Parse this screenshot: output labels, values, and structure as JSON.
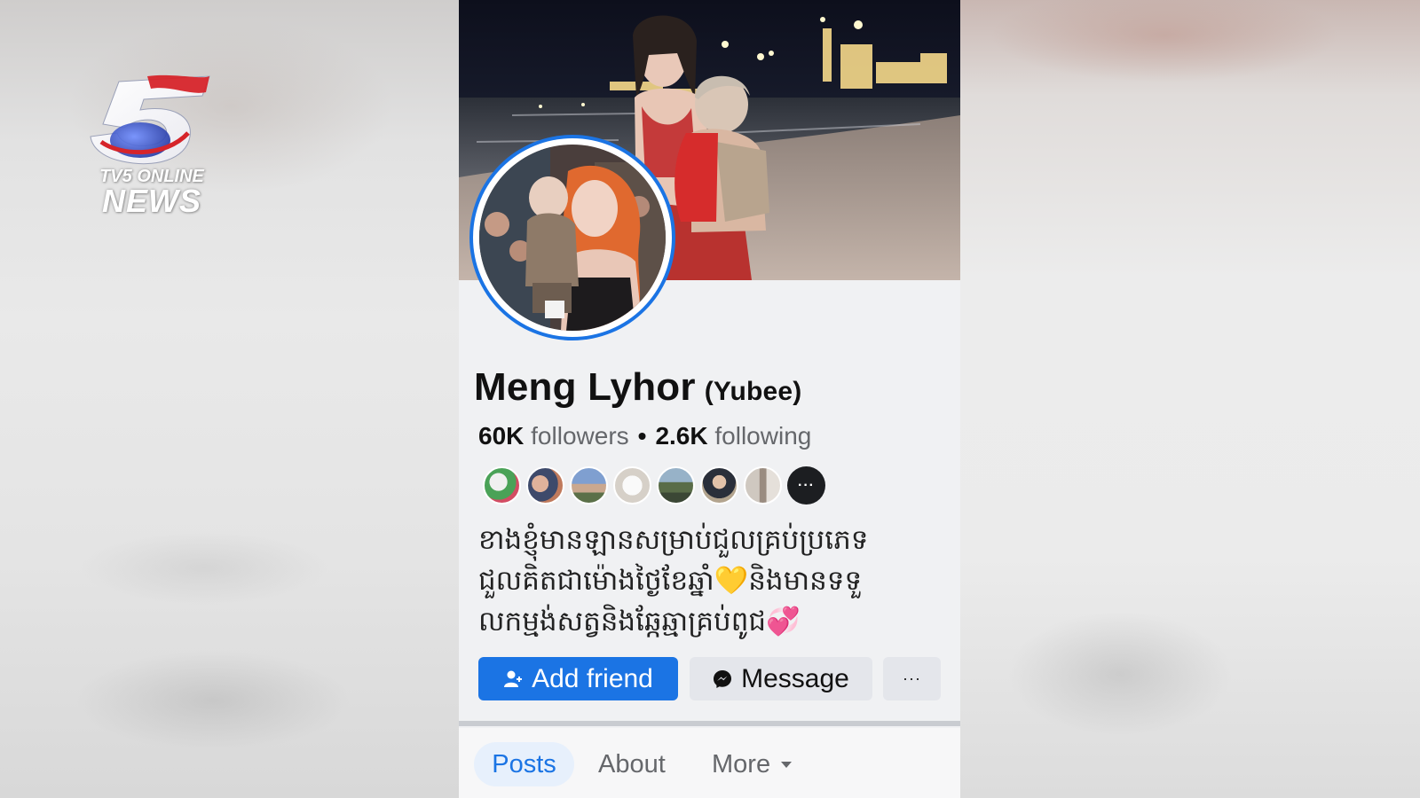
{
  "branding": {
    "channel_line1": "TV5 ONLINE",
    "channel_line2": "NEWS",
    "logo_icon": "tv5-number-five-logo"
  },
  "profile": {
    "name": "Meng Lyhor",
    "nickname": "(Yubee)",
    "followers_count": "60K",
    "followers_label": "followers",
    "separator": "•",
    "following_count": "2.6K",
    "following_label": "following",
    "more_mutuals_label": "···",
    "bio_lines": [
      "ខាងខ្ញុំមានឡានសម្រាប់ជួលគ្រប់ប្រភេទ",
      "ជួលគិតជាម៉ោងថ្ងៃខែឆ្នាំ💛និងមានទទួ",
      "លកម្មង់សត្វនិងឆ្កែឆ្មាគ្រប់ពូជ💞"
    ]
  },
  "actions": {
    "add_friend_label": "Add friend",
    "message_label": "Message",
    "more_label": "···"
  },
  "tabs": {
    "posts": "Posts",
    "about": "About",
    "more": "More"
  },
  "colors": {
    "facebook_blue": "#1b74e4",
    "secondary_button": "#e4e6eb",
    "muted_text": "#65676b"
  }
}
